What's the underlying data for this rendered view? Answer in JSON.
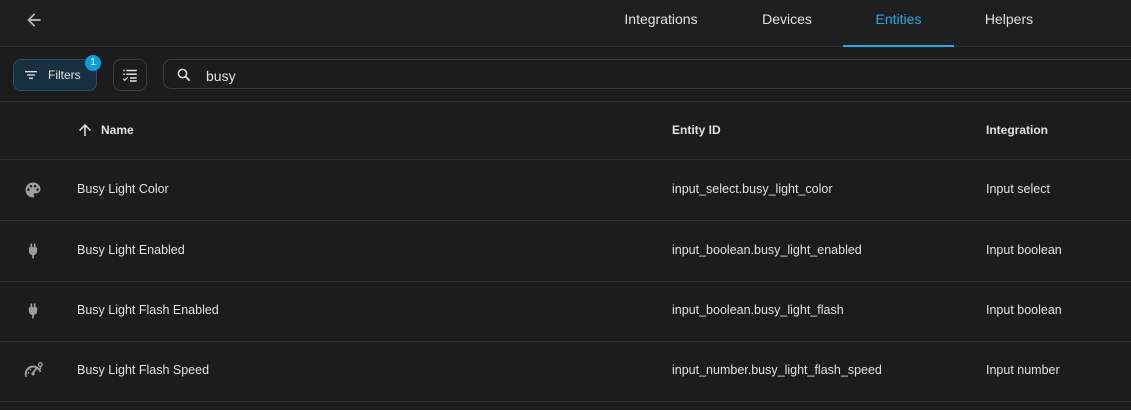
{
  "tabs": [
    {
      "label": "Integrations",
      "active": false
    },
    {
      "label": "Devices",
      "active": false
    },
    {
      "label": "Entities",
      "active": true
    },
    {
      "label": "Helpers",
      "active": false
    }
  ],
  "toolbar": {
    "filters_label": "Filters",
    "filters_badge": "1",
    "search_value": "busy"
  },
  "table": {
    "headers": {
      "name": "Name",
      "entity_id": "Entity ID",
      "integration": "Integration"
    },
    "rows": [
      {
        "icon": "palette-icon",
        "name": "Busy Light Color",
        "entity_id": "input_select.busy_light_color",
        "integration": "Input select"
      },
      {
        "icon": "power-plug-icon",
        "name": "Busy Light Enabled",
        "entity_id": "input_boolean.busy_light_enabled",
        "integration": "Input boolean"
      },
      {
        "icon": "power-plug-icon",
        "name": "Busy Light Flash Enabled",
        "entity_id": "input_boolean.busy_light_flash",
        "integration": "Input boolean"
      },
      {
        "icon": "speedometer-icon",
        "name": "Busy Light Flash Speed",
        "entity_id": "input_number.busy_light_flash_speed",
        "integration": "Input number"
      }
    ]
  },
  "colors": {
    "accent": "#29a6e4",
    "background": "#1c1c1c",
    "badge": "#0a9fdc"
  }
}
